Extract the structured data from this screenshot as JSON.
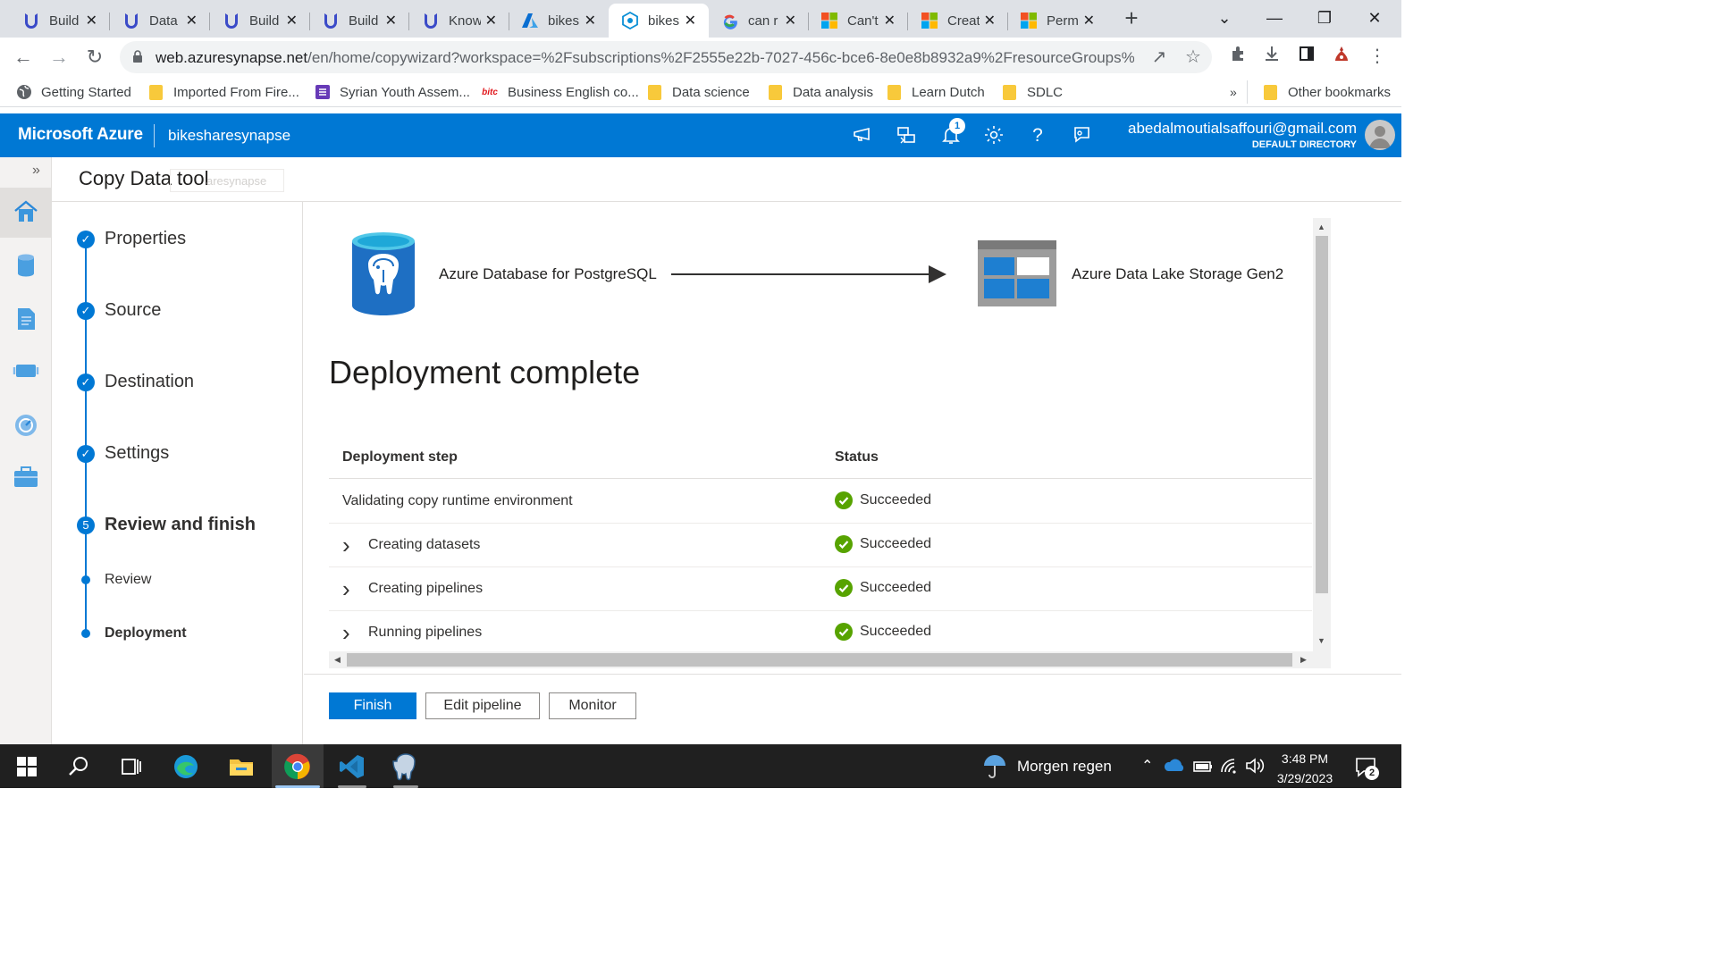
{
  "browser": {
    "tabs": [
      {
        "title": "Build",
        "icon": "udacity-icon"
      },
      {
        "title": "Data",
        "icon": "udacity-icon"
      },
      {
        "title": "Build",
        "icon": "udacity-icon"
      },
      {
        "title": "Build",
        "icon": "udacity-icon"
      },
      {
        "title": "Know",
        "icon": "udacity-icon"
      },
      {
        "title": "bikes",
        "icon": "azure-icon"
      },
      {
        "title": "bikes",
        "icon": "synapse-icon",
        "active": true
      },
      {
        "title": "can r",
        "icon": "google-icon"
      },
      {
        "title": "Can't",
        "icon": "microsoft-icon"
      },
      {
        "title": "Creat",
        "icon": "microsoft-icon"
      },
      {
        "title": "Perm",
        "icon": "microsoft-icon"
      }
    ],
    "url_host": "web.azuresynapse.net",
    "url_path": "/en/home/copywizard?workspace=%2Fsubscriptions%2F2555e22b-7027-456c-bce6-8e0e8b8932a9%2FresourceGroups%...",
    "bookmarks": [
      "Getting Started",
      "Imported From Fire...",
      "Syrian Youth Assem...",
      "Business English co...",
      "Data science",
      "Data analysis",
      "Learn Dutch",
      "SDLC"
    ],
    "bookmarks_more": "»",
    "other_bookmarks": "Other bookmarks",
    "bookmark_badge_text": "bitc"
  },
  "header": {
    "brand": "Microsoft Azure",
    "workspace": "bikesharesynapse",
    "notification_count": "1",
    "user_email": "abedalmoutialsaffouri@gmail.com",
    "directory": "DEFAULT DIRECTORY"
  },
  "page": {
    "title": "Copy Data tool",
    "ghost_text": "aresynapse"
  },
  "wizard": {
    "steps": [
      {
        "label": "Properties",
        "state": "done"
      },
      {
        "label": "Source",
        "state": "done"
      },
      {
        "label": "Destination",
        "state": "done"
      },
      {
        "label": "Settings",
        "state": "done"
      },
      {
        "label": "Review and finish",
        "state": "current",
        "number": "5"
      }
    ],
    "substeps": [
      {
        "label": "Review"
      },
      {
        "label": "Deployment"
      }
    ]
  },
  "main": {
    "source_label": "Azure Database for PostgreSQL",
    "destination_label": "Azure Data Lake Storage Gen2",
    "title": "Deployment complete",
    "col_step": "Deployment step",
    "col_status": "Status",
    "rows": [
      {
        "step": "Validating copy runtime environment",
        "status": "Succeeded",
        "expandable": false
      },
      {
        "step": "Creating datasets",
        "status": "Succeeded",
        "expandable": true
      },
      {
        "step": "Creating pipelines",
        "status": "Succeeded",
        "expandable": true
      },
      {
        "step": "Running pipelines",
        "status": "Succeeded",
        "expandable": true
      }
    ],
    "buttons": {
      "finish": "Finish",
      "edit": "Edit pipeline",
      "monitor": "Monitor"
    }
  },
  "taskbar": {
    "weather": "Morgen regen",
    "time": "3:48 PM",
    "date": "3/29/2023",
    "notifications": "2"
  },
  "colors": {
    "azure_blue": "#0078d4",
    "success_green": "#57a300",
    "chrome_tabstrip": "#dee1e6"
  }
}
